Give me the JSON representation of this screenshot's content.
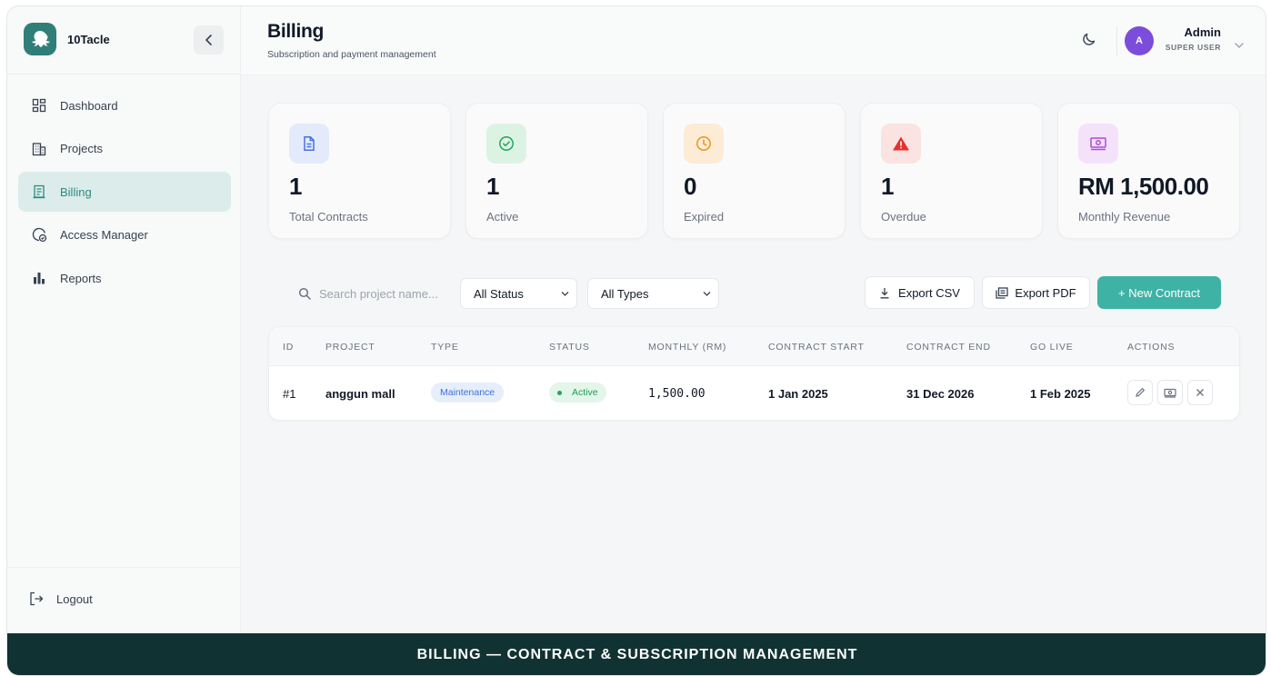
{
  "app": {
    "name": "10Tacle"
  },
  "header": {
    "title": "Billing",
    "subtitle": "Subscription and payment management",
    "user": {
      "initial": "A",
      "name": "Admin",
      "role": "SUPER USER"
    }
  },
  "sidebar": {
    "items": [
      {
        "label": "Dashboard",
        "icon": "dashboard-icon",
        "active": false
      },
      {
        "label": "Projects",
        "icon": "building-icon",
        "active": false
      },
      {
        "label": "Billing",
        "icon": "receipt-icon",
        "active": true
      },
      {
        "label": "Access Manager",
        "icon": "access-icon",
        "active": false
      },
      {
        "label": "Reports",
        "icon": "bar-chart-icon",
        "active": false
      }
    ],
    "logout_label": "Logout"
  },
  "stats": [
    {
      "value": "1",
      "label": "Total Contracts",
      "icon": "document-icon",
      "color": "#4a6fe0",
      "bg": "#e3eafb"
    },
    {
      "value": "1",
      "label": "Active",
      "icon": "check-circle-icon",
      "color": "#22a559",
      "bg": "#dcf3e4"
    },
    {
      "value": "0",
      "label": "Expired",
      "icon": "clock-icon",
      "color": "#e8951c",
      "bg": "#fcecd6"
    },
    {
      "value": "1",
      "label": "Overdue",
      "icon": "alert-triangle-icon",
      "color": "#e5312f",
      "bg": "#fbe3e1"
    },
    {
      "value": "RM 1,500.00",
      "label": "Monthly Revenue",
      "icon": "money-icon",
      "color": "#b04ad6",
      "bg": "#f4e2fb"
    }
  ],
  "toolbar": {
    "search_placeholder": "Search project name...",
    "status_filter": "All Status",
    "type_filter": "All Types",
    "export_csv": "Export CSV",
    "export_pdf": "Export PDF",
    "new_contract": "+ New Contract"
  },
  "table": {
    "columns": [
      "ID",
      "PROJECT",
      "TYPE",
      "STATUS",
      "MONTHLY (RM)",
      "CONTRACT START",
      "CONTRACT END",
      "GO LIVE",
      "ACTIONS"
    ],
    "rows": [
      {
        "id": "#1",
        "project": "anggun mall",
        "type": "Maintenance",
        "status": "Active",
        "monthly": "1,500.00",
        "contract_start": "1 Jan 2025",
        "contract_end": "31 Dec 2026",
        "go_live": "1 Feb 2025"
      }
    ]
  },
  "banner": {
    "text": "BILLING — CONTRACT & SUBSCRIPTION MANAGEMENT"
  },
  "colors": {
    "accent": "#3fb2a6",
    "banner": "#113233",
    "active_nav_bg": "#dcecea"
  }
}
